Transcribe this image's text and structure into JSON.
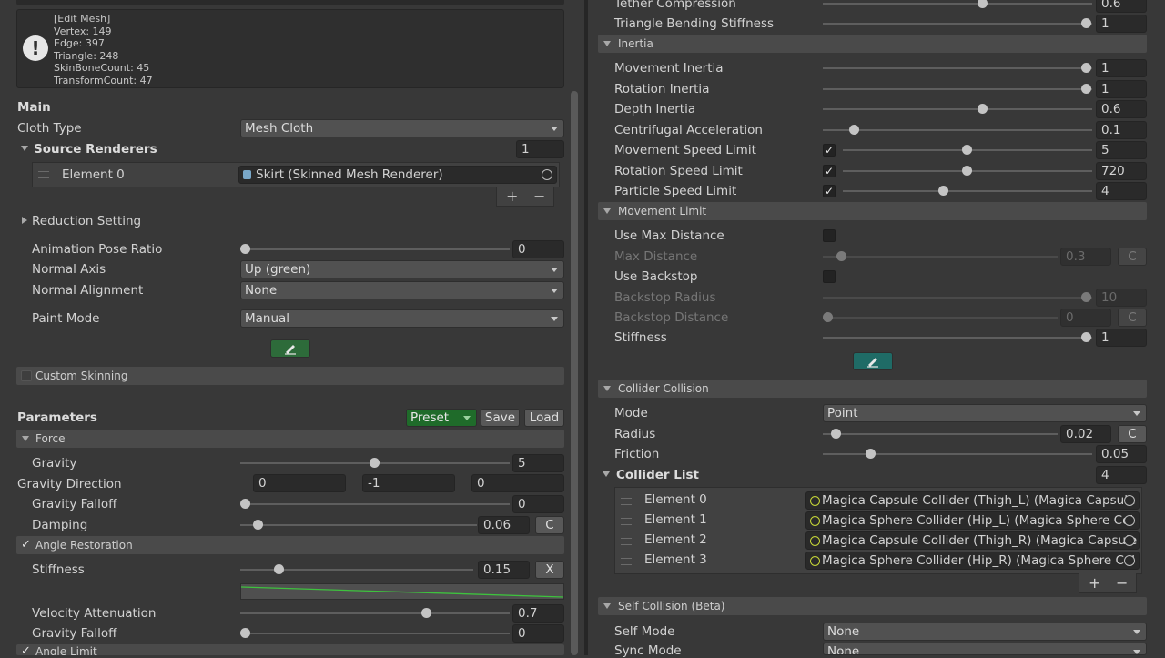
{
  "info": {
    "lines": [
      "[Edit Mesh]",
      "Vertex: 149",
      "Edge: 397",
      "Triangle: 248",
      "SkinBoneCount: 45",
      "TransformCount: 47"
    ]
  },
  "main": {
    "title": "Main",
    "cloth_type": {
      "label": "Cloth Type",
      "value": "Mesh Cloth"
    },
    "source_renderers": {
      "label": "Source Renderers",
      "count": "1",
      "element_label": "Element 0",
      "element_value": "Skirt (Skinned Mesh Renderer)"
    },
    "plus": "+",
    "minus": "−",
    "reduction": "Reduction Setting",
    "animation_pose_ratio": {
      "label": "Animation Pose Ratio",
      "value": "0"
    },
    "normal_axis": {
      "label": "Normal Axis",
      "value": "Up (green)"
    },
    "normal_alignment": {
      "label": "Normal Alignment",
      "value": "None"
    },
    "paint_mode": {
      "label": "Paint Mode",
      "value": "Manual"
    },
    "custom_skinning": "Custom Skinning"
  },
  "parameters": {
    "title": "Parameters",
    "preset": "Preset",
    "save": "Save",
    "load": "Load",
    "force_header": "Force",
    "gravity": {
      "label": "Gravity",
      "value": "5"
    },
    "gravity_direction": {
      "label": "Gravity Direction",
      "x": "0",
      "y": "-1",
      "z": "0"
    },
    "gravity_falloff": {
      "label": "Gravity Falloff",
      "value": "0"
    },
    "damping": {
      "label": "Damping",
      "value": "0.06",
      "button": "C"
    },
    "angle_restoration": "Angle Restoration",
    "stiffness": {
      "label": "Stiffness",
      "value": "0.15",
      "button": "X"
    },
    "velocity_attenuation": {
      "label": "Velocity Attenuation",
      "value": "0.7"
    },
    "gravity_falloff2": {
      "label": "Gravity Falloff",
      "value": "0"
    },
    "angle_limit": "Angle Limit"
  },
  "right": {
    "tether_compression": {
      "label": "Tether Compression",
      "value": "0.6"
    },
    "triangle_bending": {
      "label": "Triangle Bending Stiffness",
      "value": "1"
    },
    "inertia_header": "Inertia",
    "movement_inertia": {
      "label": "Movement Inertia",
      "value": "1"
    },
    "rotation_inertia": {
      "label": "Rotation Inertia",
      "value": "1"
    },
    "depth_inertia": {
      "label": "Depth Inertia",
      "value": "0.6"
    },
    "centrifugal": {
      "label": "Centrifugal Acceleration",
      "value": "0.1"
    },
    "movement_speed_limit": {
      "label": "Movement Speed Limit",
      "value": "5"
    },
    "rotation_speed_limit": {
      "label": "Rotation Speed Limit",
      "value": "720"
    },
    "particle_speed_limit": {
      "label": "Particle Speed Limit",
      "value": "4"
    },
    "movement_limit_header": "Movement Limit",
    "use_max_distance": "Use Max Distance",
    "max_distance": {
      "label": "Max Distance",
      "value": "0.3",
      "button": "C"
    },
    "use_backstop": "Use Backstop",
    "backstop_radius": {
      "label": "Backstop Radius",
      "value": "10"
    },
    "backstop_distance": {
      "label": "Backstop Distance",
      "value": "0",
      "button": "C"
    },
    "ml_stiffness": {
      "label": "Stiffness",
      "value": "1"
    },
    "collider_header": "Collider Collision",
    "mode": {
      "label": "Mode",
      "value": "Point"
    },
    "radius": {
      "label": "Radius",
      "value": "0.02",
      "button": "C"
    },
    "friction": {
      "label": "Friction",
      "value": "0.05"
    },
    "collider_list": {
      "label": "Collider List",
      "count": "4"
    },
    "colliders": [
      {
        "label": "Element 0",
        "value": "Magica Capsule Collider (Thigh_L) (Magica Capsule"
      },
      {
        "label": "Element 1",
        "value": "Magica Sphere Collider (Hip_L) (Magica Sphere Col"
      },
      {
        "label": "Element 2",
        "value": "Magica Capsule Collider (Thigh_R) (Magica Capsule"
      },
      {
        "label": "Element 3",
        "value": "Magica Sphere Collider (Hip_R) (Magica Sphere Col"
      }
    ],
    "plus": "+",
    "minus": "−",
    "self_collision_header": "Self Collision (Beta)",
    "self_mode": {
      "label": "Self Mode",
      "value": "None"
    },
    "sync_mode": {
      "label": "Sync Mode",
      "value": "None"
    }
  },
  "colors": {
    "preset_green": "#1f6b2a",
    "edit_green": "#2d6b3a",
    "edit_teal": "#1f6b66"
  }
}
